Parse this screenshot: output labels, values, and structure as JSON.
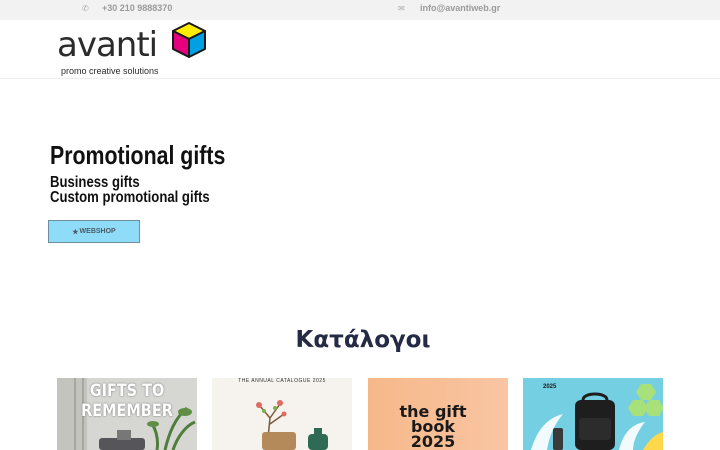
{
  "topbar": {
    "phone": "+30 210 9888370",
    "email": "info@avantiweb.gr",
    "phone_icon": "phone-icon",
    "email_icon": "envelope-icon"
  },
  "logo": {
    "word": "avanti",
    "tagline": "promo creative solutions",
    "colors": [
      "#e6007e",
      "#00a0e3",
      "#ffed00"
    ]
  },
  "hero": {
    "title": "Promotional gifts",
    "subtitles": [
      "Business gifts",
      "Custom promotional gifts"
    ],
    "button_label": "WEBSHOP",
    "button_icon": "star-icon"
  },
  "catalogues": {
    "title": "Κατάλογοι",
    "items": [
      {
        "text": "GIFTS TO REMEMBER"
      },
      {
        "text": "THE ANNUAL CATALOGUE 2025"
      },
      {
        "text": "the gift book 2025"
      },
      {
        "text": "2025"
      }
    ]
  }
}
